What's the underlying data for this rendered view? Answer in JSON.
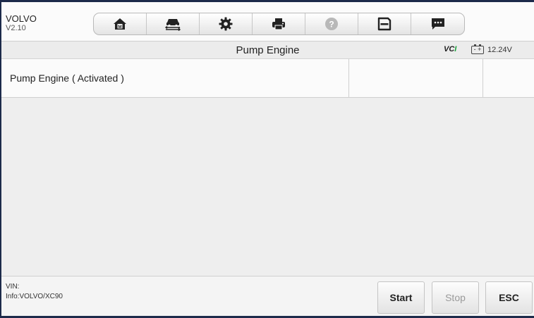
{
  "header": {
    "brand": "VOLVO",
    "version": "V2.10"
  },
  "toolbar": {
    "buttons": [
      {
        "name": "home",
        "icon": "home-icon"
      },
      {
        "name": "vehicle-swap",
        "icon": "car-swap-icon"
      },
      {
        "name": "settings",
        "icon": "gear-icon"
      },
      {
        "name": "print",
        "icon": "printer-icon"
      },
      {
        "name": "help",
        "icon": "help-icon"
      },
      {
        "name": "save",
        "icon": "save-icon"
      },
      {
        "name": "data-logging",
        "icon": "message-icon"
      }
    ]
  },
  "titlebar": {
    "title": "Pump Engine",
    "vci_label": "VCI",
    "voltage": "12.24V",
    "vci_color": "#1aa33c"
  },
  "table": {
    "rows": [
      {
        "name": "Pump Engine ( Activated )",
        "value": "",
        "unit": ""
      }
    ]
  },
  "footer": {
    "vin": "VIN:",
    "info": "Info:VOLVO/XC90",
    "buttons": {
      "start": "Start",
      "stop": "Stop",
      "esc": "ESC"
    }
  }
}
